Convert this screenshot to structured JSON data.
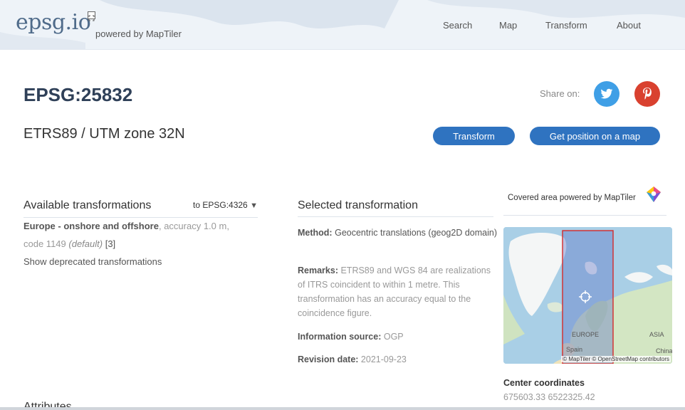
{
  "header": {
    "logo_main": "epsg.",
    "logo_io": "io",
    "powered_by": "powered by MapTiler",
    "nav": [
      "Search",
      "Map",
      "Transform",
      "About"
    ]
  },
  "page": {
    "code": "EPSG:25832",
    "name": "ETRS89 / UTM zone 32N",
    "share_label": "Share on:",
    "transform_button": "Transform",
    "get_position_button": "Get position on a map"
  },
  "available": {
    "title": "Available transformations",
    "target": "to EPSG:4326",
    "target_arrow": "▼",
    "item_name": "Europe - onshore and offshore",
    "item_accuracy": ", accuracy 1.0 m,",
    "item_code": "code 1149",
    "item_default": "(default)",
    "item_ref": "[3]",
    "deprecated_link": "Show deprecated transformations"
  },
  "selected": {
    "title": "Selected transformation",
    "method_label": "Method:",
    "method_value": "Geocentric translations (geog2D domain)",
    "remarks_label": "Remarks:",
    "remarks_value": "ETRS89 and WGS 84 are realizations of ITRS coincident to within 1 metre. This transformation has an accuracy equal to the coincidence figure.",
    "source_label": "Information source:",
    "source_value": "OGP",
    "revision_label": "Revision date:",
    "revision_value": "2021-09-23"
  },
  "coverage": {
    "title": "Covered area powered by MapTiler",
    "label_europe": "EUROPE",
    "label_asia": "ASIA",
    "label_china": "China",
    "label_spain": "Spain",
    "attribution": "© MapTiler © OpenStreetMap contributors",
    "center_title": "Center coordinates",
    "center_value": "675603.33 6522325.42"
  },
  "attributes_title": "Attributes",
  "colors": {
    "accent_button": "#2f73c0",
    "twitter": "#3f9fe6",
    "pinterest": "#d9412f",
    "coverage_outline": "#d42a2a"
  },
  "icons": [
    "expand-icon",
    "twitter-icon",
    "pinterest-icon",
    "maptiler-logo-icon",
    "map-crosshair-icon"
  ]
}
